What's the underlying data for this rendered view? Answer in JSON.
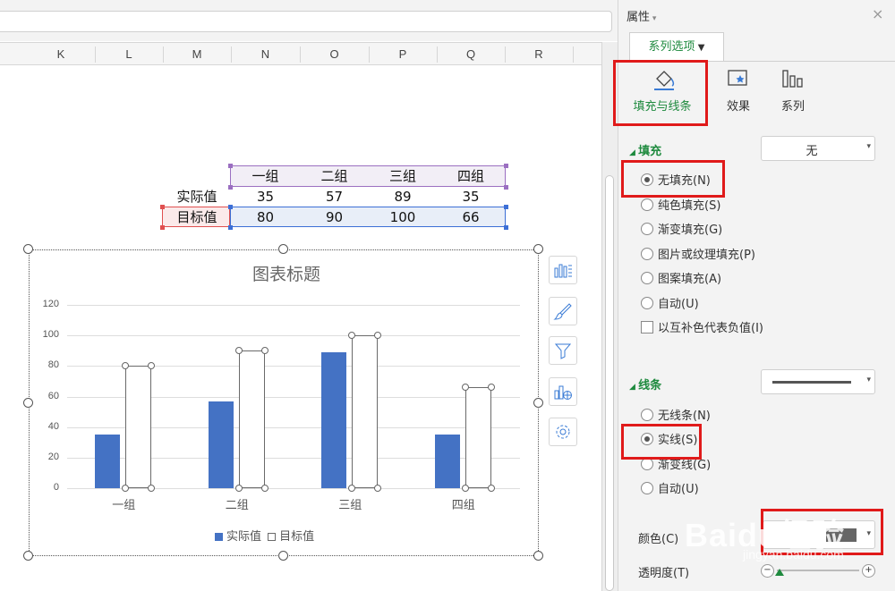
{
  "columns": [
    "K",
    "L",
    "M",
    "N",
    "O",
    "P",
    "Q",
    "R"
  ],
  "table": {
    "headers": [
      "一组",
      "二组",
      "三组",
      "四组"
    ],
    "rows": [
      {
        "label": "实际值",
        "values": [
          "35",
          "57",
          "89",
          "35"
        ]
      },
      {
        "label": "目标值",
        "values": [
          "80",
          "90",
          "100",
          "66"
        ]
      }
    ]
  },
  "chart_data": {
    "type": "bar",
    "title": "图表标题",
    "categories": [
      "一组",
      "二组",
      "三组",
      "四组"
    ],
    "series": [
      {
        "name": "实际值",
        "values": [
          35,
          57,
          89,
          35
        ],
        "color": "#4472c4",
        "fill": "solid"
      },
      {
        "name": "目标值",
        "values": [
          80,
          90,
          100,
          66
        ],
        "color": "#6a6a6a",
        "fill": "none"
      }
    ],
    "ylim": [
      0,
      120
    ],
    "yticks": [
      "0",
      "20",
      "40",
      "60",
      "80",
      "100",
      "120"
    ],
    "grid": true,
    "legend": "bottom"
  },
  "chart_tools": [
    "chart-elements-icon",
    "chart-style-icon",
    "chart-filter-icon",
    "chart-layout-icon",
    "chart-settings-icon"
  ],
  "panel": {
    "title": "属性",
    "close": "×",
    "series_tab": "系列选项",
    "tabs": [
      {
        "label": "填充与线条",
        "icon": "fill-bucket-icon",
        "active": true
      },
      {
        "label": "效果",
        "icon": "effects-icon",
        "active": false
      },
      {
        "label": "系列",
        "icon": "series-icon",
        "active": false
      }
    ],
    "fill": {
      "heading": "填充",
      "dropdown_value": "无",
      "options": [
        "无填充(N)",
        "纯色填充(S)",
        "渐变填充(G)",
        "图片或纹理填充(P)",
        "图案填充(A)",
        "自动(U)"
      ],
      "selected": 0,
      "checkbox": "以互补色代表负值(I)"
    },
    "line": {
      "heading": "线条",
      "options": [
        "无线条(N)",
        "实线(S)",
        "渐变线(G)",
        "自动(U)"
      ],
      "selected": 1,
      "color_label": "颜色(C)",
      "transparency_label": "透明度(T)"
    }
  },
  "watermark": {
    "text": "Baidu经验",
    "url": "jingyan.baidu.com"
  },
  "colors": {
    "accent_green": "#1e8a3e",
    "highlight_red": "#e01a1a",
    "bar_blue": "#4472c4"
  }
}
